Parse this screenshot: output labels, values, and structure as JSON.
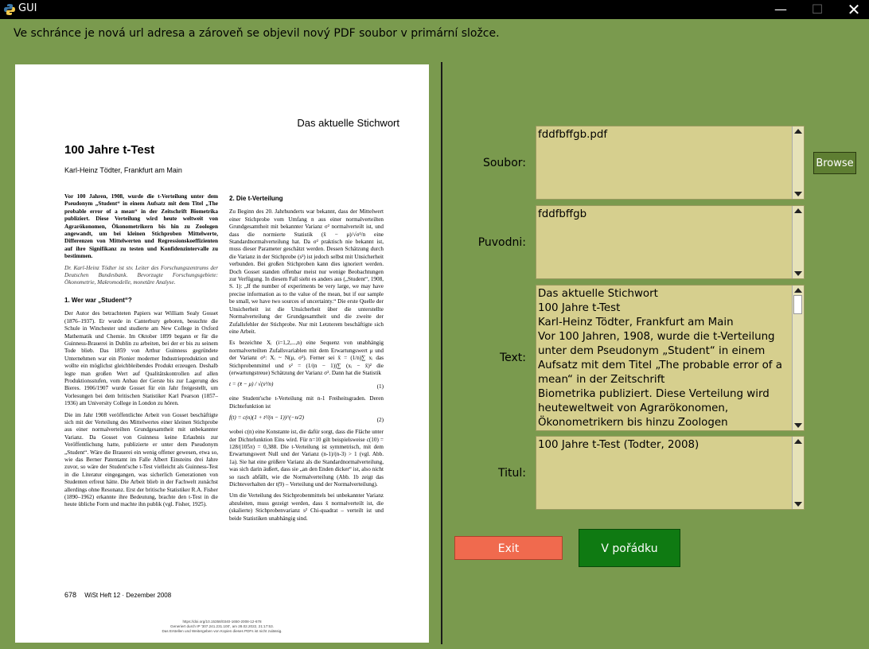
{
  "window": {
    "title": "GUI",
    "minimize_label": "—",
    "maximize_label": "☐",
    "close_label": "✕"
  },
  "message": "Ve schránce je nová url adresa a zároveň se objevil nový PDF soubor v primární složce.",
  "document": {
    "header": "Das aktuelle Stichwort",
    "title": "100 Jahre t-Test",
    "author": "Karl-Heinz Tödter, Frankfurt am Main",
    "abstract": "Vor 100 Jahren, 1908, wurde die t-Verteilung unter dem Pseudonym „Student“ in einem Aufsatz mit dem Titel „The probable error of a mean“ in der Zeitschrift Biometrika publiziert. Diese Verteilung wird heute weltweit von Agrarökonomen, Ökonometrikern bis hin zu Zoologen angewandt, um bei kleinen Stichproben Mittelwerte, Differenzen von Mittelwerten und Regressionskoeffizienten auf ihre Signifikanz zu testen und Konfidenzintervalle zu bestimmen.",
    "bio": "Dr. Karl-Heinz Tödter ist stv. Leiter des Forschungszentrums der Deutschen Bundesbank. Bevorzugte Forschungsgebiete: Ökonometrie, Makromodelle, monetäre Analyse.",
    "section1_title": "1. Wer war „Student“?",
    "section1_p1": "Der Autor des betrachteten Papiers war William Sealy Gosset (1876–1937). Er wurde in Canterbury geboren, besuchte die Schule in Winchester und studierte am New College in Oxford Mathematik und Chemie. Im Oktober 1899 begann er für die Guinness-Brauerei in Dublin zu arbeiten, bei der er bis zu seinem Tode blieb. Das 1859 von Arthur Guinness gegründete Unternehmen war ein Pionier moderner Industrieproduktion und wollte ein möglichst gleichbleibendes Produkt erzeugen. Deshalb legte man großen Wert auf Qualitätskontrollen auf allen Produktionsstufen, vom Anbau der Gerste bis zur Lagerung des Bieres. 1906/1907 wurde Gosset für ein Jahr freigestellt, um Vorlesungen bei dem britischen Statistiker Karl Pearson (1857–1936) am University College in London zu hören.",
    "section1_p2": "Die im Jahr 1908 veröffentlichte Arbeit von Gosset beschäftigte sich mit der Verteilung des Mittelwertes einer kleinen Stichprobe aus einer normalverteilten Grundgesamtheit mit unbekannter Varianz. Da Gosset von Guinness keine Erlaubnis zur Veröffentlichung hatte, publizierte er unter dem Pseudonym „Student“. Wäre die Brauerei ein wenig offener gewesen, etwa so, wie das Berner Patentamt im Falle Albert Einsteins drei Jahre zuvor, so wäre der Student'sche t-Test vielleicht als Guinness-Test in die Literatur eingegangen, was sicherlich Generationen von Studenten erfreut hätte. Die Arbeit blieb in der Fachwelt zunächst allerdings ohne Resonanz. Erst der britische Statistiker R.A. Fisher (1890–1962) erkannte ihre Bedeutung, brachte den t-Test in die heute übliche Form und machte ihn publik (vgl. Fisher, 1925).",
    "section2_title": "2. Die t-Verteilung",
    "section2_p1": "Zu Beginn des 20. Jahrhunderts war bekannt, dass der Mittelwert einer Stichprobe vom Umfang n aus einer normalverteilten Grundgesamtheit mit bekannter Varianz σ² normalverteilt ist, und dass die normierte Statistik (x̄ − μ)/√σ²/n eine Standardnormalverteilung hat. Da σ² praktisch nie bekannt ist, muss dieser Parameter geschätzt werden. Dessen Schätzung durch die Varianz in der Stichprobe (s²) ist jedoch selbst mit Unsicherheit verbunden. Bei großen Stichproben kann dies ignoriert werden. Doch Gosset standen offenbar meist nur wenige Beobachtungen zur Verfügung. In diesem Fall sieht es anders aus („Student“, 1908, S. 1): „If the number of experiments be very large, we may have precise information as to the value of the mean, but if our sample be small, we have two sources of uncertainty.“ Die erste Quelle der Unsicherheit ist die Unsicherheit über die unterstellte Normalverteilung der Grundgesamtheit und die zweite der Zufallsfehler der Stichprobe. Nur mit Letzterem beschäftigte sich eine Arbeit.",
    "section2_p2": "Es bezeichne Xᵢ (i=1,2,...,n) eine Sequenz von unabhängig normalverteilten Zufallsvariablen mit dem Erwartungswert μ und der Varianz σ²: Xᵢ ~ N(μ, σ²). Ferner sei x̄ = (1/n)∑ xᵢ das Stichprobenmittel und s² = (1/(n − 1))∑ (xᵢ − x̄)² die (erwartungstreue) Schätzung der Varianz σ². Dann hat die Statistik",
    "formula1": "t = (x̄ − μ) / √(s²/n)",
    "formula1_num": "(1)",
    "section2_p3": "eine Student'sche t-Verteilung mit n-1 Freiheitsgraden. Deren Dichtefunktion ist",
    "formula2": "f(t) = c(n)(1 + t²/(n − 1))^(−n/2)",
    "formula2_num": "(2)",
    "section2_p4": "wobei c(n) eine Konstante ist, die dafür sorgt, dass die Fläche unter der Dichtefunktion Eins wird. Für n=10 gilt beispielsweise c(10) = 128/(105π) = 0,388. Die t-Verteilung ist symmetrisch, mit dem Erwartungswert Null und der Varianz (n-1)/(n-3) > 1 (vgl. Abb. 1a). Sie hat eine größere Varianz als die Standardnormalverteilung, was sich darin äußert, dass sie „an den Enden dicker“ ist, also nicht so rasch abfällt, wie die Normalverteilung (Abb. 1b zeigt das Dichteverhalten der t(9) – Verteilung und der Normalverteilung).",
    "section2_p5": "Um die Verteilung des Stichprobenmittels bei unbekannter Varianz abzuleiten, muss gezeigt werden, dass x̄ normalverteilt ist, die (skalierte) Stichprobenvarianz s² Chi-quadrat – verteilt ist und beide Statistiken unabhängig sind.",
    "page_number": "678",
    "issue": "WiSt Heft 12 · Dezember 2008",
    "fine1": "https://doi.org/10.15358/0340-1650-2008-12-678",
    "fine2": "Generiert durch IP '307.241.231.100', am 28.02.2022, 21:17:53.",
    "fine3": "Das Erstellen und Weitergeben von Kopien dieses PDFs ist nicht zulässig."
  },
  "form": {
    "soubor_label": "Soubor:",
    "soubor_value": "fddfbffgb.pdf",
    "browse_label": "Browse",
    "puvodni_label": "Puvodni:",
    "puvodni_value": "fddfbffgb",
    "text_label": "Text:",
    "text_value": "Das aktuelle Stichwort\n100 Jahre t-Test\nKarl-Heinz Tödter, Frankfurt am Main\nVor 100 Jahren, 1908, wurde die t-Verteilung unter dem Pseudonym „Student“ in einem Aufsatz mit dem Titel „The probable error of a mean“ in der Zeitschrift\nBiometrika publiziert. Diese Verteilung wird heuteweltweit von Agrarökonomen, Ökonometrikern bis hinzu Zoologen angewandt, um bei kleinen",
    "text_scroll_fraction": 0.15,
    "titul_label": "Titul:",
    "titul_value": "100 Jahre t-Test (Todter, 2008)",
    "exit_label": "Exit",
    "ok_label": "V pořádku"
  },
  "colors": {
    "background": "#7a9a4e",
    "field": "#d6cf8e",
    "exit": "#f06a4e",
    "ok": "#0f7a12",
    "browse": "#5e7e32"
  }
}
